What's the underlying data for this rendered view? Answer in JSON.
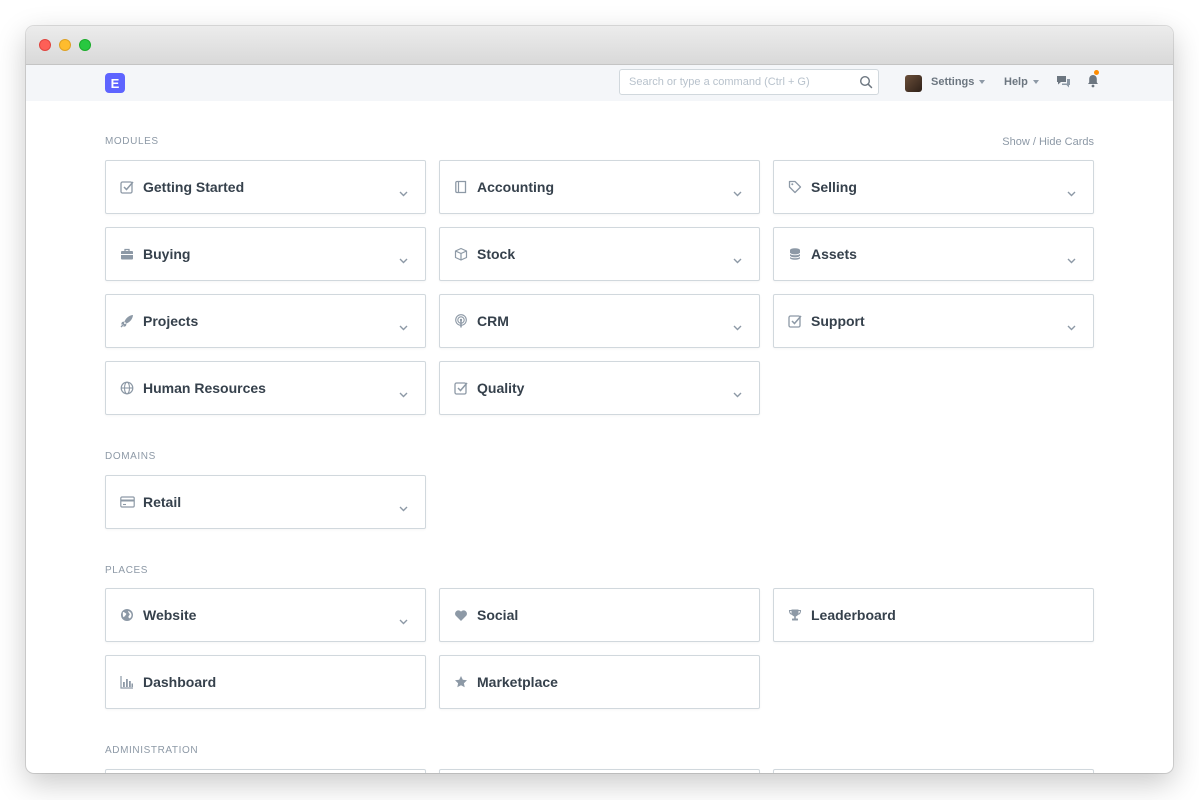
{
  "navbar": {
    "logo_letter": "E",
    "search_placeholder": "Search or type a command (Ctrl + G)",
    "settings_label": "Settings",
    "help_label": "Help"
  },
  "toggle_cards_label": "Show / Hide Cards",
  "sections": {
    "modules": {
      "title": "MODULES",
      "cards": [
        {
          "label": "Getting Started",
          "icon": "checkbox-icon"
        },
        {
          "label": "Accounting",
          "icon": "book-icon"
        },
        {
          "label": "Selling",
          "icon": "tag-icon"
        },
        {
          "label": "Buying",
          "icon": "briefcase-icon"
        },
        {
          "label": "Stock",
          "icon": "box-icon"
        },
        {
          "label": "Assets",
          "icon": "database-icon"
        },
        {
          "label": "Projects",
          "icon": "rocket-icon"
        },
        {
          "label": "CRM",
          "icon": "broadcast-icon"
        },
        {
          "label": "Support",
          "icon": "checkbox-icon"
        },
        {
          "label": "Human Resources",
          "icon": "globe-icon"
        },
        {
          "label": "Quality",
          "icon": "checkbox-icon"
        }
      ]
    },
    "domains": {
      "title": "DOMAINS",
      "cards": [
        {
          "label": "Retail",
          "icon": "credit-card-icon"
        }
      ]
    },
    "places": {
      "title": "PLACES",
      "cards": [
        {
          "label": "Website",
          "icon": "globe-filled-icon"
        },
        {
          "label": "Social",
          "icon": "heart-icon"
        },
        {
          "label": "Leaderboard",
          "icon": "trophy-icon"
        },
        {
          "label": "Dashboard",
          "icon": "bar-chart-icon"
        },
        {
          "label": "Marketplace",
          "icon": "star-icon"
        }
      ]
    },
    "administration": {
      "title": "ADMINISTRATION"
    }
  }
}
